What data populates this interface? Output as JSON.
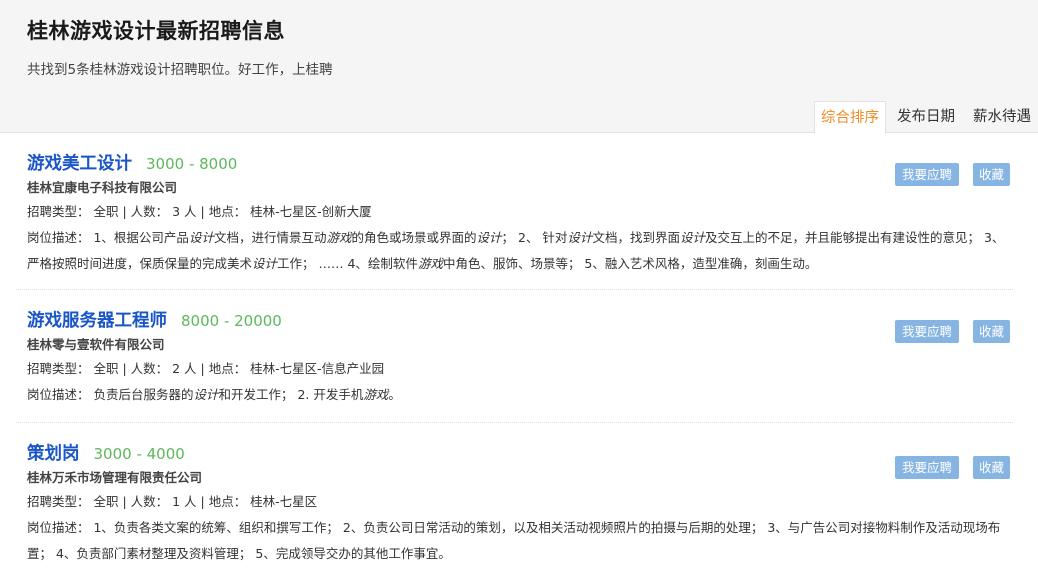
{
  "header": {
    "title": "桂林游戏设计最新招聘信息",
    "subtitle": "共找到5条桂林游戏设计招聘职位。好工作，上桂聘"
  },
  "sort_tabs": [
    {
      "label": "综合排序",
      "active": true
    },
    {
      "label": "发布日期",
      "active": false
    },
    {
      "label": "薪水待遇",
      "active": false
    }
  ],
  "colors": {
    "title_blue": "#1a56c8",
    "salary_green": "#5cb85c",
    "active_tab_orange": "#f08c28",
    "button_blue": "#86b4e3"
  },
  "jobs": [
    {
      "title": "游戏美工设计",
      "salary": "3000 - 8000",
      "company": "桂林宜康电子科技有限公司",
      "meta": "招聘类型： 全职 | 人数： 3 人 | 地点： 桂林-七星区-创新大厦",
      "desc_parts": [
        "岗位描述： 1、根据公司产品",
        "设计",
        "文档，进行情景互动",
        "游戏",
        "的角色或场景或界面的",
        "设计",
        "； 2、 针对",
        "设计",
        "文档，找到界面",
        "设计",
        "及交互上的不足，并且能够提出有建设性的意见； 3、严格按照时间进度，保质保量的完成美术",
        "设计",
        "工作； …… 4、绘制软件",
        "游戏",
        "中角色、服饰、场景等； 5、融入艺术风格，造型准确，刻画生动。"
      ],
      "apply_label": "我要应聘",
      "fav_label": "收藏"
    },
    {
      "title": "游戏服务器工程师",
      "salary": "8000 - 20000",
      "company": "桂林零与壹软件有限公司",
      "meta": "招聘类型： 全职 | 人数： 2 人 | 地点： 桂林-七星区-信息产业园",
      "desc_parts": [
        "岗位描述： 负责后台服务器的",
        "设计",
        "和开发工作； 2. 开发手机",
        "游戏",
        "。"
      ],
      "apply_label": "我要应聘",
      "fav_label": "收藏"
    },
    {
      "title": "策划岗",
      "salary": "3000 - 4000",
      "company": "桂林万禾市场管理有限责任公司",
      "meta": "招聘类型： 全职 | 人数： 1 人 | 地点： 桂林-七星区",
      "desc_parts": [
        "岗位描述： 1、负责各类文案的统筹、组织和撰写工作； 2、负责公司日常活动的策划，以及相关活动视频照片的拍摄与后期的处理； 3、与广告公司对接物料制作及活动现场布置； 4、负责部门素材整理及资料管理； 5、完成领导交办的其他工作事宜。"
      ],
      "apply_label": "我要应聘",
      "fav_label": "收藏"
    }
  ]
}
